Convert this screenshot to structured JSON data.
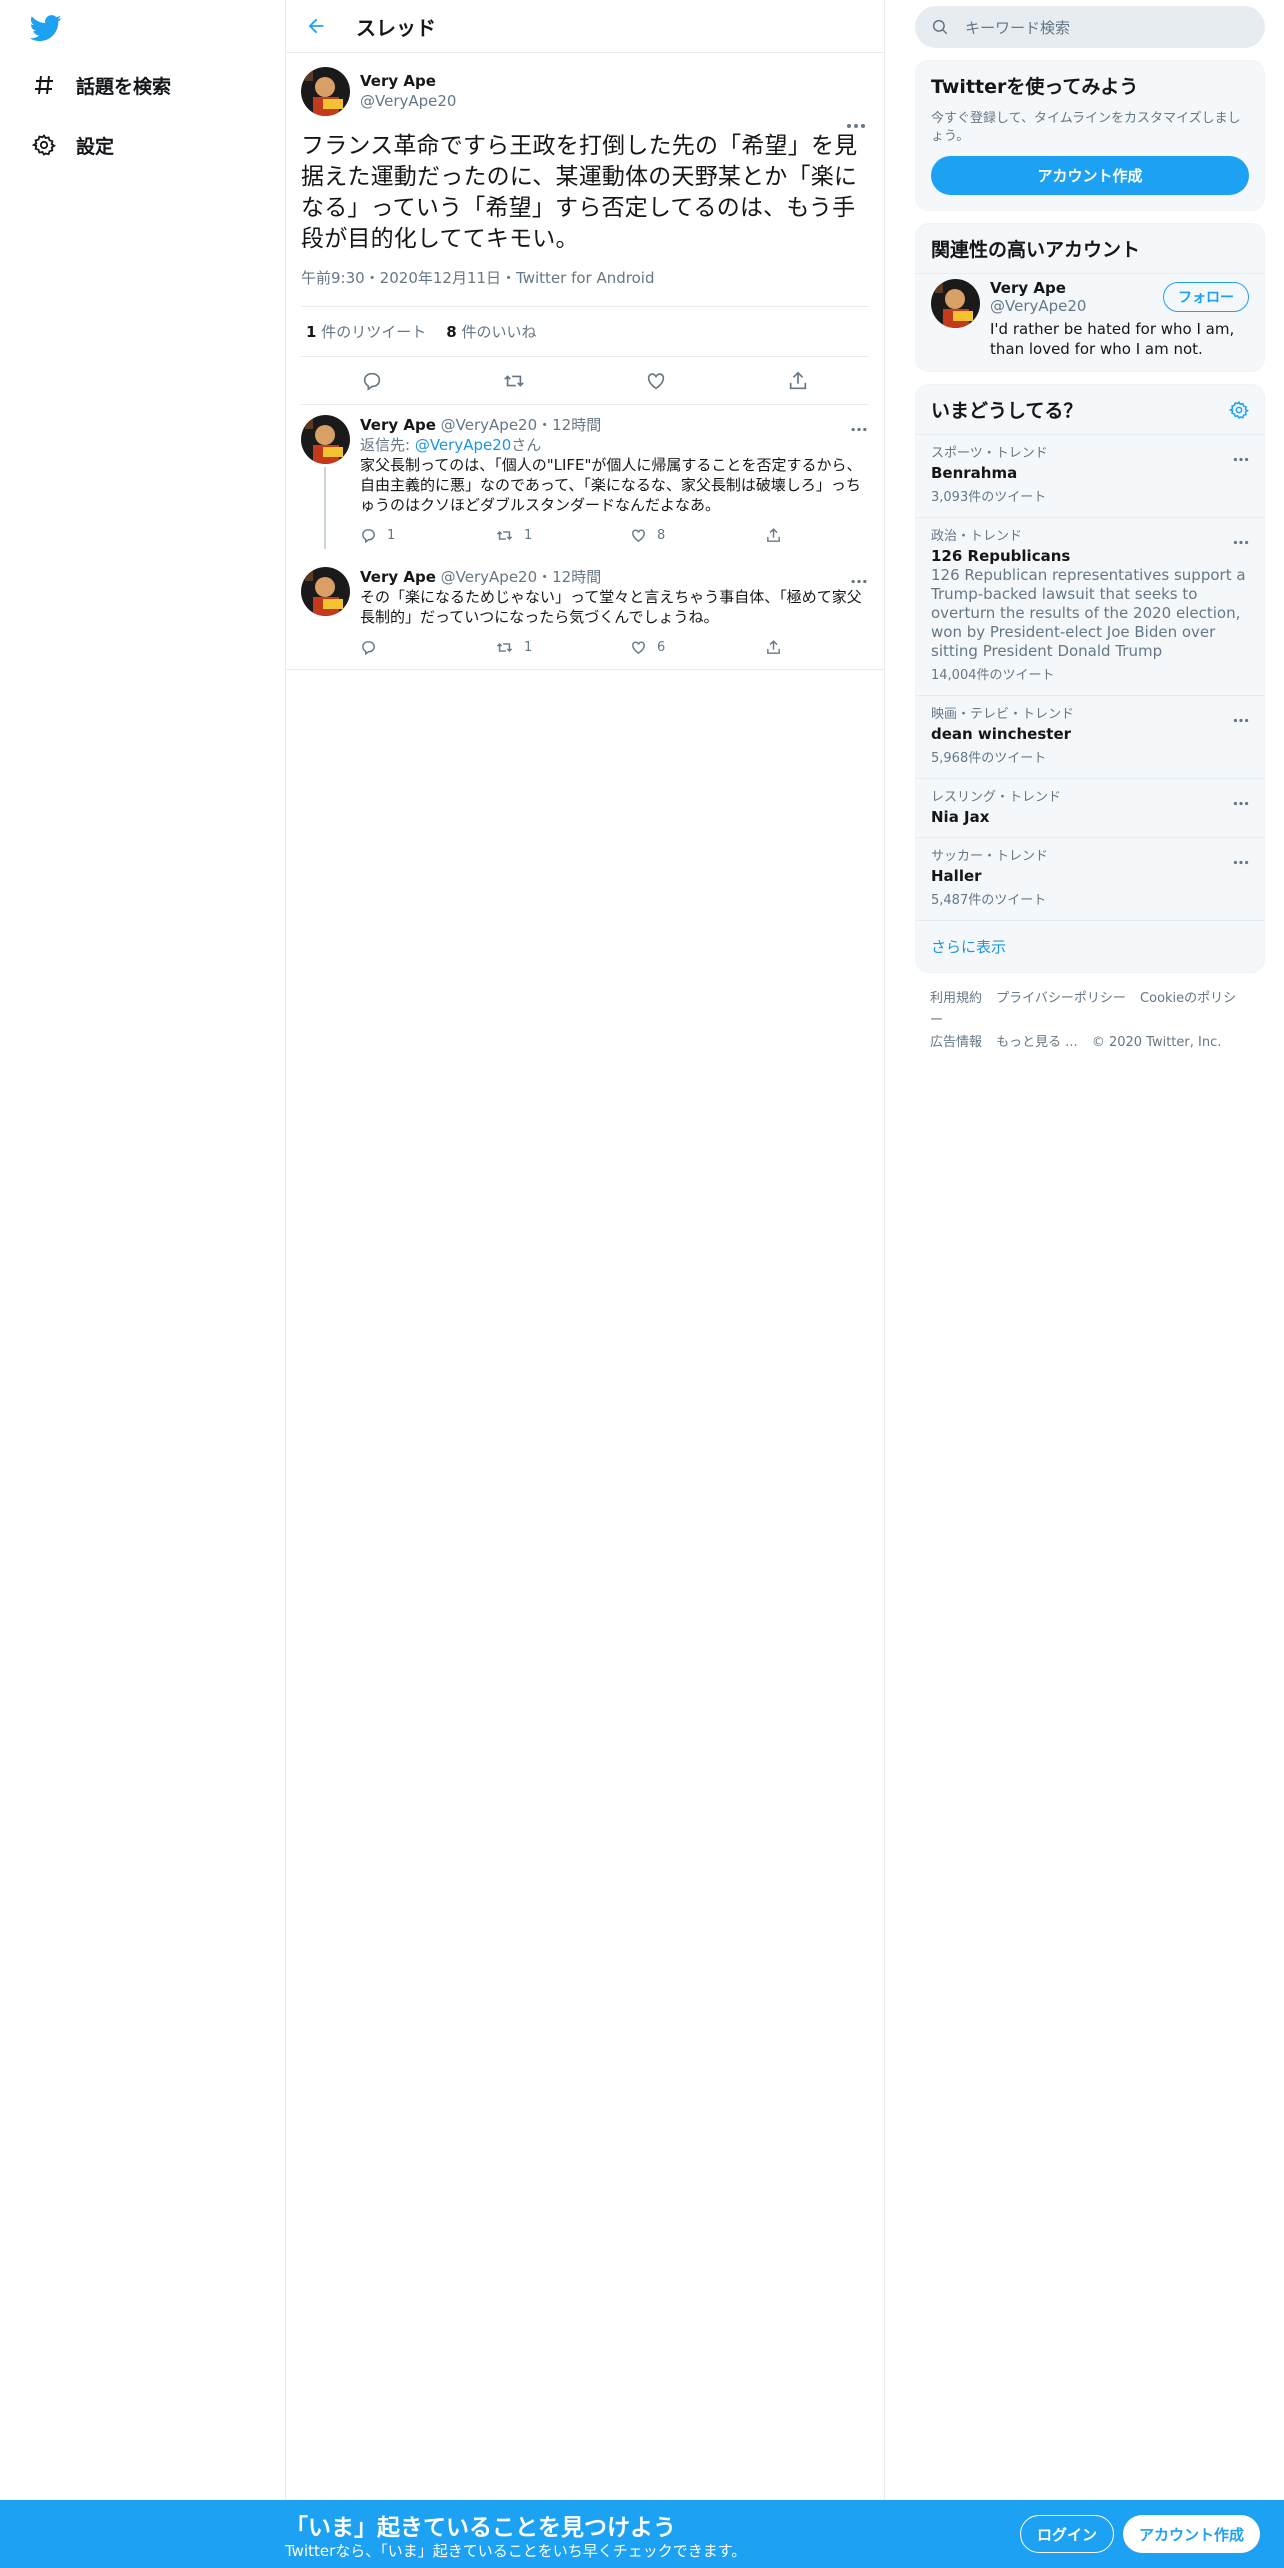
{
  "nav": {
    "items": [
      {
        "label": "話題を検索",
        "icon": "hashtag-icon"
      },
      {
        "label": "設定",
        "icon": "gear-icon"
      }
    ]
  },
  "header": {
    "title": "スレッド"
  },
  "tweet": {
    "name": "Very Ape",
    "handle": "@VeryApe20",
    "text": "フランス革命ですら王政を打倒した先の「希望」を見据えた運動だったのに、某運動体の天野某とか「楽になる」っていう「希望」すら否定してるのは、もう手段が目的化しててキモい。",
    "meta": "午前9:30・2020年12月11日・Twitter for Android",
    "retweets_count": "1",
    "retweets_label": "件のリツイート",
    "likes_count": "8",
    "likes_label": "件のいいね"
  },
  "replies": [
    {
      "name": "Very Ape",
      "handle": "@VeryApe20",
      "time": "・12時間",
      "reply_prefix": "返信先: ",
      "reply_to": "@VeryApe20",
      "reply_suffix": "さん",
      "text": "家父長制ってのは、「個人の\"LIFE\"が個人に帰属することを否定するから、自由主義的に悪」なのであって、「楽になるな、家父長制は破壊しろ」っちゅうのはクソほどダブルスタンダードなんだよなあ。",
      "replies": "1",
      "retweets": "1",
      "likes": "8"
    },
    {
      "name": "Very Ape",
      "handle": "@VeryApe20",
      "time": "・12時間",
      "text": "その「楽になるためじゃない」って堂々と言えちゃう事自体、「極めて家父長制的」だっていつになったら気づくんでしょうね。",
      "replies": "",
      "retweets": "1",
      "likes": "6"
    }
  ],
  "search": {
    "placeholder": "キーワード検索"
  },
  "signup_card": {
    "title": "Twitterを使ってみよう",
    "desc": "今すぐ登録して、タイムラインをカスタマイズしましょう。",
    "button": "アカウント作成"
  },
  "related": {
    "title": "関連性の高いアカウント",
    "name": "Very Ape",
    "handle": "@VeryApe20",
    "bio": "I'd rather be hated for who I am, than loved for who I am not.",
    "follow": "フォロー"
  },
  "trends": {
    "title": "いまどうしてる？",
    "items": [
      {
        "category": "スポーツ・トレンド",
        "name": "Benrahma",
        "desc": "",
        "count": "3,093件のツイート"
      },
      {
        "category": "政治・トレンド",
        "name": "126 Republicans",
        "desc": "126 Republican representatives support a Trump-backed lawsuit that seeks to overturn the results of the 2020 election, won by President-elect Joe Biden over sitting President Donald Trump",
        "count": "14,004件のツイート"
      },
      {
        "category": "映画・テレビ・トレンド",
        "name": "dean winchester",
        "desc": "",
        "count": "5,968件のツイート"
      },
      {
        "category": "レスリング・トレンド",
        "name": "Nia Jax",
        "desc": "",
        "count": ""
      },
      {
        "category": "サッカー・トレンド",
        "name": "Haller",
        "desc": "",
        "count": "5,487件のツイート"
      }
    ],
    "show_more": "さらに表示"
  },
  "footer": {
    "links": [
      "利用規約",
      "プライバシーポリシー",
      "Cookieのポリシー",
      "広告情報",
      "もっと見る ..."
    ],
    "copyright": "© 2020 Twitter, Inc."
  },
  "bottom_bar": {
    "title": "「いま」起きていることを見つけよう",
    "subtitle": "Twitterなら、「いま」起きていることをいち早くチェックできます。",
    "login": "ログイン",
    "signup": "アカウント作成"
  },
  "colors": {
    "accent": "#1da1f2",
    "link": "#1b95e0",
    "muted": "#657786",
    "border": "#e6ecf0"
  }
}
